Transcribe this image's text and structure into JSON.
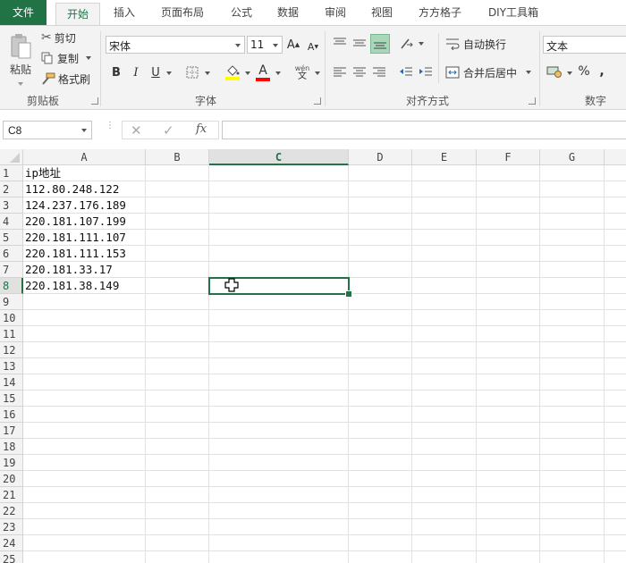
{
  "tabs": [
    "文件",
    "开始",
    "插入",
    "页面布局",
    "公式",
    "数据",
    "审阅",
    "视图",
    "方方格子",
    "DIY工具箱"
  ],
  "ribbon": {
    "clipboard": {
      "paste": "粘贴",
      "cut": "剪切",
      "copy": "复制",
      "format_painter": "格式刷",
      "label": "剪贴板"
    },
    "font": {
      "name": "宋体",
      "size": "11",
      "bold": "B",
      "italic": "I",
      "underline": "U",
      "label": "字体"
    },
    "alignment": {
      "wrap": "自动换行",
      "merge": "合并后居中",
      "label": "对齐方式"
    },
    "number": {
      "format": "文本",
      "label": "数字",
      "percent": "%",
      "comma": ","
    }
  },
  "formula_bar": {
    "name_box": "C8",
    "fx": "fx",
    "value": ""
  },
  "columns": [
    "A",
    "B",
    "C",
    "D",
    "E",
    "F",
    "G"
  ],
  "selected_column": "C",
  "selected_row": "8",
  "rows": [
    "1",
    "2",
    "3",
    "4",
    "5",
    "6",
    "7",
    "8",
    "9",
    "10",
    "11",
    "12",
    "13",
    "14",
    "15",
    "16",
    "17",
    "18",
    "19",
    "20",
    "21",
    "22",
    "23",
    "24",
    "25"
  ],
  "cells_A": [
    "ip地址",
    "112.80.248.122",
    "124.237.176.189",
    "220.181.107.199",
    "220.181.111.107",
    "220.181.111.153",
    "220.181.33.17",
    "220.181.38.149"
  ],
  "colors": {
    "accent": "#217346",
    "fill_highlight": "#ffff00",
    "font_color": "#ff0000"
  }
}
